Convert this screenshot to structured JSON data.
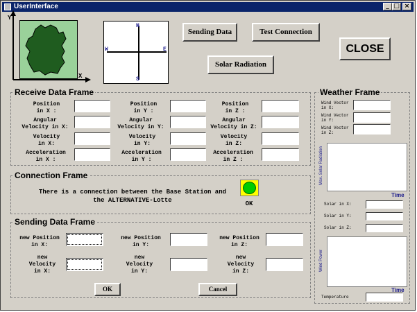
{
  "window": {
    "title": "UserInterface",
    "controls": [
      "_",
      "□",
      "×"
    ]
  },
  "axes_small": {
    "y": "Y",
    "x": "X"
  },
  "compass": {
    "n": "N",
    "s": "S",
    "w": "W",
    "e": "E"
  },
  "buttons": {
    "sending_data": "Sending Data",
    "test_connection": "Test Connection",
    "solar_radiation": "Solar Radiation",
    "close": "CLOSE",
    "ok": "OK",
    "cancel": "Cancel"
  },
  "receive": {
    "title": "Receive Data Frame",
    "labels": [
      "Position\nin X :",
      "Position\nin Y :",
      "Position\nin Z :",
      "Angular\nVelocity in X:",
      "Angular\nVelocity in Y:",
      "Angular\nVelocity in Z:",
      "Velocity\nin X:",
      "Velocity\nin Y:",
      "Velocity\nin Z:",
      "Acceleration\nin X :",
      "Acceleration\nin Y :",
      "Acceleration\nin Z :"
    ]
  },
  "connection": {
    "title": "Connection Frame",
    "message_line1": "There is a connection between the Base Station and",
    "message_line2": "the ALTERNATIVE-Lotte",
    "status": "OK",
    "status_color": "#00cc00"
  },
  "sending": {
    "title": "Sending Data Frame",
    "labels": [
      "new Position\nin X:",
      "new Position\nin Y:",
      "new Position\nin Z:",
      "new\nVelocity\nin X:",
      "new\nVelocity\nin Y:",
      "new\nVelocity\nin Z:"
    ]
  },
  "weather": {
    "title": "Weather Frame",
    "wind_labels": [
      "Wind Vector\nin X:",
      "Wind Vector\nin Y:",
      "Wind Vector\nin Z:"
    ],
    "chart1_ylabel": "Max. Solar Radiation",
    "chart1_xlabel": "Time",
    "solar_labels": [
      "Solar in X:",
      "Solar in Y:",
      "Solar in Z:"
    ],
    "chart2_ylabel": "Wind Power",
    "chart2_xlabel": "Time",
    "temperature_label": "Temperature"
  }
}
